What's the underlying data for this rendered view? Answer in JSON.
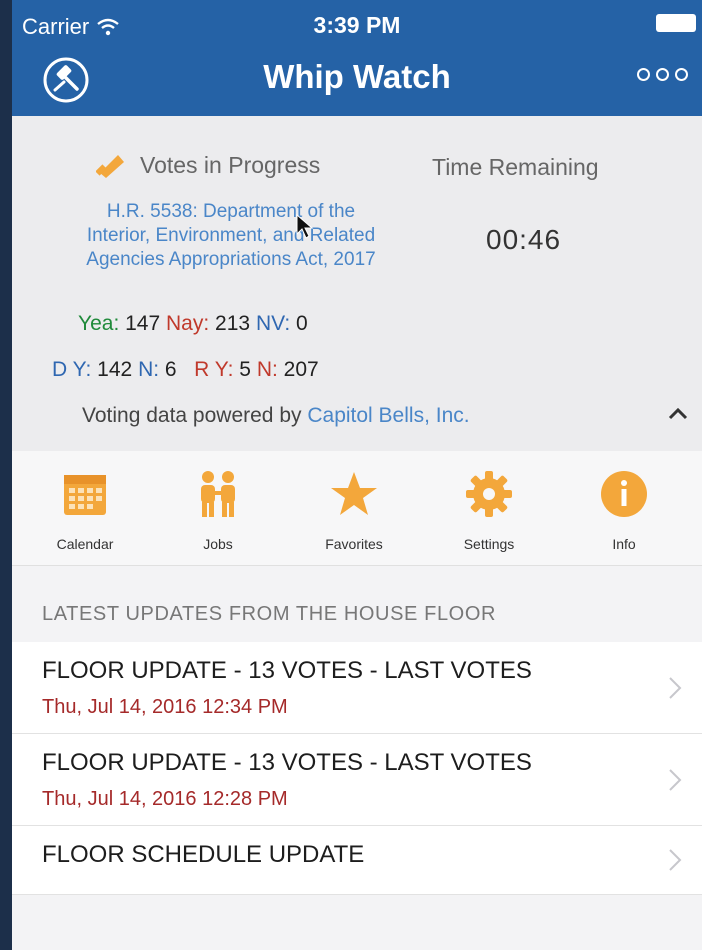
{
  "status_bar": {
    "carrier": "Carrier",
    "time": "3:39 PM"
  },
  "nav": {
    "title": "Whip Watch"
  },
  "votes": {
    "heading": "Votes in Progress",
    "time_label": "Time Remaining",
    "bill": "H.R. 5538: Department of the Interior, Environment, and Related Agencies Appropriations Act, 2017",
    "countdown": "00:46",
    "tally": {
      "yea_label": "Yea:",
      "yea": "147",
      "nay_label": "Nay:",
      "nay": "213",
      "nv_label": "NV:",
      "nv": "0"
    },
    "party": {
      "d_label": "D",
      "dy_label": "Y:",
      "dy": "142",
      "dn_label": "N:",
      "dn": "6",
      "r_label": "R",
      "ry_label": "Y:",
      "ry": "5",
      "rn_label": "N:",
      "rn": "207"
    },
    "powered_prefix": "Voting data powered by",
    "powered_link": "Capitol Bells, Inc."
  },
  "actions": [
    {
      "label": "Calendar",
      "icon": "calendar-icon"
    },
    {
      "label": "Jobs",
      "icon": "people-icon"
    },
    {
      "label": "Favorites",
      "icon": "star-icon"
    },
    {
      "label": "Settings",
      "icon": "gear-icon"
    },
    {
      "label": "Info",
      "icon": "info-icon"
    }
  ],
  "updates": {
    "header": "LATEST UPDATES FROM THE HOUSE FLOOR",
    "items": [
      {
        "title": "FLOOR UPDATE - 13 VOTES - LAST VOTES",
        "date": "Thu, Jul 14, 2016 12:34 PM"
      },
      {
        "title": "FLOOR UPDATE - 13 VOTES - LAST VOTES",
        "date": "Thu, Jul 14, 2016 12:28 PM"
      },
      {
        "title": "FLOOR SCHEDULE UPDATE",
        "date": ""
      }
    ]
  },
  "colors": {
    "brand": "#2562a6",
    "accent": "#f3a73b",
    "link": "#4a86c8",
    "date": "#a52a2a"
  }
}
